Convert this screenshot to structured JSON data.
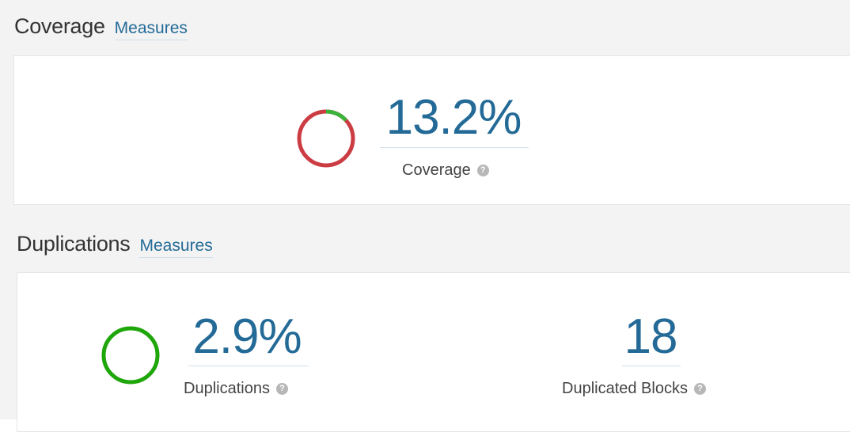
{
  "coverage_section": {
    "title": "Coverage",
    "measures_link": "Measures",
    "value": "13.2%",
    "label": "Coverage",
    "help_icon": "?",
    "donut": {
      "fraction": 0.132,
      "covered_color": "#3bb33b",
      "uncovered_color": "#cc3c43"
    }
  },
  "duplications_section": {
    "title": "Duplications",
    "measures_link": "Measures",
    "duplications_value": "2.9%",
    "duplications_label": "Duplications",
    "blocks_value": "18",
    "blocks_label": "Duplicated Blocks",
    "help_icon": "?",
    "indicator_color": "#1fa60a"
  },
  "colors": {
    "accent": "#236a97",
    "background": "#f3f3f3"
  }
}
